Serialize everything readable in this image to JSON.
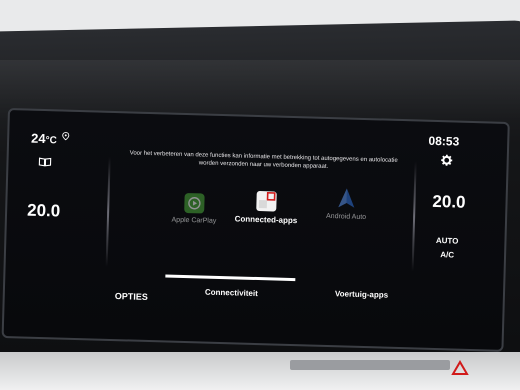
{
  "status": {
    "outside_temp_value": "24",
    "outside_temp_unit": "°C",
    "time": "08:53"
  },
  "climate": {
    "temp_left": "20.0",
    "temp_right": "20.0",
    "auto_label": "AUTO",
    "ac_label": "A/C"
  },
  "info": {
    "message": "Voor het verbeteren van deze functies kan informatie met betrekking tot autogegevens en autolocatie worden verzonden naar uw verbonden apparaat."
  },
  "apps": [
    {
      "label": "Apple CarPlay",
      "icon": "carplay-icon",
      "color": "#4aa83a",
      "enabled": false
    },
    {
      "label": "Connected-apps",
      "icon": "connected-apps-icon",
      "color": "#f2f2f2",
      "enabled": true
    },
    {
      "label": "Android Auto",
      "icon": "android-auto-icon",
      "color": "#2f6fd6",
      "enabled": false
    }
  ],
  "tabs": {
    "options": "OPTIES",
    "connectivity": "Connectiviteit",
    "vehicle_apps": "Voertuig-apps",
    "active": "Connectiviteit"
  },
  "colors": {
    "accent": "#d11a1a",
    "screen_bg": "#0a0b0e",
    "text": "#ffffff"
  }
}
